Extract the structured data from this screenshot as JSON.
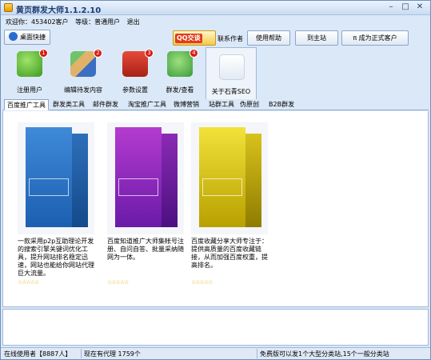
{
  "window": {
    "title": "黄页群发大师1.1.2.10"
  },
  "userbar": {
    "welcome": "欢迎你：453402客户",
    "level": "等级：普通用户",
    "logout": "退出"
  },
  "topbar": {
    "desktop_label": "桌面快捷",
    "qq_badge": "QQ交谈",
    "contact_label": "联系作者",
    "help_label": "使用帮助",
    "main_label": "到主站",
    "pay_label": "π 成为正式客户"
  },
  "toolbar": {
    "items": [
      {
        "label": "注册用户",
        "badge": "1"
      },
      {
        "label": "编辑待发内容",
        "badge": "2"
      },
      {
        "label": "参数设置",
        "badge": "3"
      },
      {
        "label": "群发/查看",
        "badge": "4"
      },
      {
        "label": "关于石青SEO"
      }
    ]
  },
  "tabs": [
    {
      "label": "百度推广工具"
    },
    {
      "label": "群发类工具"
    },
    {
      "label": "邮件群发"
    },
    {
      "label": "淘宝推广工具"
    },
    {
      "label": "微博营销"
    },
    {
      "label": "站群工具"
    },
    {
      "label": "伪原创"
    },
    {
      "label": "B2B群发"
    }
  ],
  "products": [
    {
      "desc": "一款采用p2p互助理论开发的搜索引擎关键词优化工具，提升网站排名稳定迅速，网站也能给你网站代理巨大流量。",
      "stars": "☆☆☆☆☆"
    },
    {
      "desc": "百度知道推广大师集帐号注册、自问自答、批量采纳随网为一体。",
      "stars": "☆☆☆☆☆"
    },
    {
      "desc": "百度收藏分享大师专注于：提供高质量的百度收藏链接，从而加强百度权重，提高排名。",
      "stars": "☆☆☆☆☆"
    }
  ],
  "status": {
    "online": "在线使用者【8887人】",
    "count": "现在有代理 1759个",
    "notice": "免费版可以发1个大型分类站,15个一般分类站"
  },
  "colors": {
    "accent": "#2a6bd1",
    "badge": "#d71b10",
    "stars": "#e0a800"
  }
}
